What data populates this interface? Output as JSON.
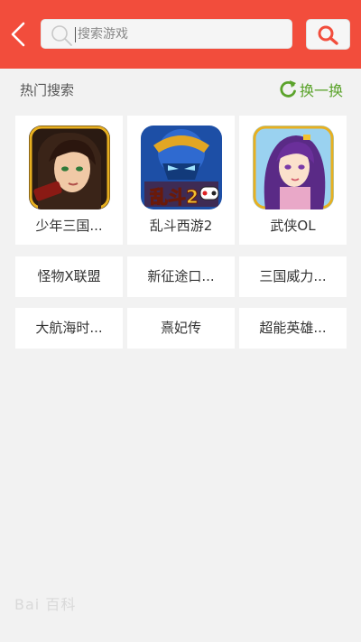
{
  "header": {
    "back_icon": "back-chevron-icon",
    "search_placeholder": "搜索游戏",
    "search_button_icon": "search-icon",
    "bar_color": "#f24d3c"
  },
  "hot_search": {
    "title": "热门搜索",
    "refresh_label": "换一换",
    "refresh_icon": "refresh-icon",
    "accent_color": "#5ba32b",
    "games": [
      {
        "name": "少年三国...",
        "icon": "game-icon-shaonian-sanguo"
      },
      {
        "name": "乱斗西游2",
        "icon": "game-icon-luandou-xiyou2"
      },
      {
        "name": "武侠OL",
        "icon": "game-icon-wuxia-ol"
      }
    ],
    "keywords": [
      [
        "怪物X联盟",
        "新征途口...",
        "三国威力..."
      ],
      [
        "大航海时...",
        "熹妃传",
        "超能英雄..."
      ]
    ]
  },
  "watermark": "Bai 百科"
}
